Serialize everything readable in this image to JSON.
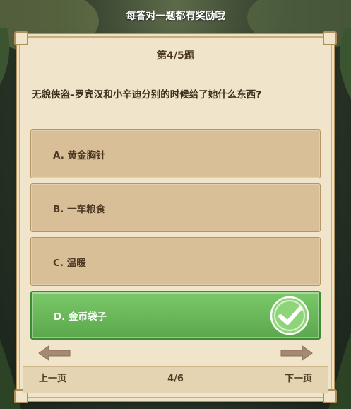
{
  "banner": {
    "text": "每答对一题都有奖励哦"
  },
  "quiz": {
    "progress": "第4/5题",
    "question": "无貌侠盗–罗宾汉和小辛迪分别的时候给了她什么东西?",
    "options": [
      {
        "label": "A. 黄金胸针",
        "state": "normal"
      },
      {
        "label": "B. 一车粮食",
        "state": "normal"
      },
      {
        "label": "C. 温暖",
        "state": "normal"
      },
      {
        "label": "D. 金币袋子",
        "state": "correct"
      }
    ]
  },
  "footer": {
    "prev_label": "上一页",
    "page_indicator": "4/6",
    "next_label": "下一页"
  },
  "colors": {
    "card_bg": "#f0e5cb",
    "option_bg": "#d8bf98",
    "correct_green": "#6bb85a",
    "text_brown": "#4d3a25"
  },
  "icons": {
    "correct": "checkmark-icon",
    "prev": "arrow-left-icon",
    "next": "arrow-right-icon"
  }
}
